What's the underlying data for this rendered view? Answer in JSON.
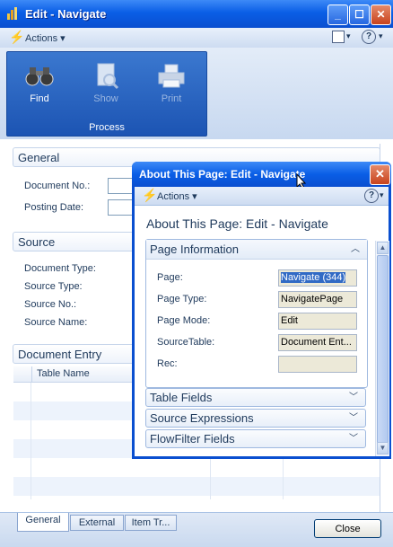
{
  "window": {
    "title": "Edit - Navigate"
  },
  "actionbar": {
    "actions_label": "Actions"
  },
  "ribbon": {
    "buttons": [
      {
        "label": "Find",
        "icon": "binoculars-icon",
        "enabled": true
      },
      {
        "label": "Show",
        "icon": "document-magnifier-icon",
        "enabled": false
      },
      {
        "label": "Print",
        "icon": "printer-icon",
        "enabled": false
      }
    ],
    "group_label": "Process"
  },
  "general": {
    "header": "General",
    "fields": [
      {
        "label": "Document No.:"
      },
      {
        "label": "Posting Date:"
      }
    ]
  },
  "source": {
    "header": "Source",
    "fields": [
      {
        "label": "Document Type:"
      },
      {
        "label": "Source Type:"
      },
      {
        "label": "Source No.:"
      },
      {
        "label": "Source Name:"
      }
    ]
  },
  "document_entry": {
    "header": "Document Entry",
    "columns": [
      "Table Name"
    ]
  },
  "bottom_tabs": [
    "General",
    "External",
    "Item Tr..."
  ],
  "close_label": "Close",
  "dialog": {
    "title": "About This Page: Edit - Navigate",
    "actions_label": "Actions",
    "heading": "About This Page: Edit - Navigate",
    "page_info": {
      "header": "Page Information",
      "rows": [
        {
          "label": "Page:",
          "value": "Navigate (344)"
        },
        {
          "label": "Page Type:",
          "value": "NavigatePage"
        },
        {
          "label": "Page Mode:",
          "value": "Edit"
        },
        {
          "label": "SourceTable:",
          "value": "Document Ent..."
        },
        {
          "label": "Rec:",
          "value": ""
        }
      ]
    },
    "collapsed_tabs": [
      "Table Fields",
      "Source Expressions",
      "FlowFilter Fields"
    ]
  },
  "colors": {
    "titlebar": "#0a5ee6",
    "ribbon_group": "#1c54b3",
    "text": "#1e395b"
  }
}
